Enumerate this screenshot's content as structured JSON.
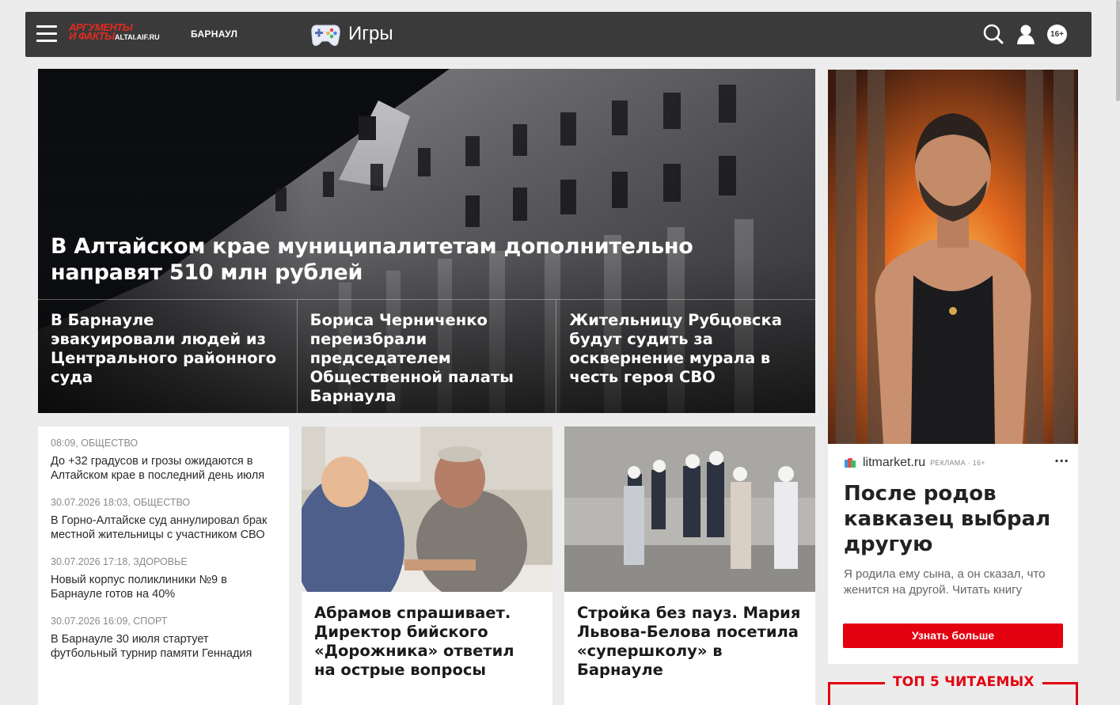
{
  "header": {
    "logo_line1": "АРГУМЕНТЫ",
    "logo_line2": "И ФАКТЫ",
    "logo_domain": "ALTAI.AIF.RU",
    "city": "БАРНАУЛ",
    "games_label": "Игры",
    "age_badge": "16+",
    "icons": [
      "menu-icon",
      "search-icon",
      "user-icon"
    ]
  },
  "hero": {
    "title": "В Алтайском крае муниципалитетам дополнительно направят 510 млн рублей",
    "sub_items": [
      "В Барнауле эвакуировали людей из Центрального районного суда",
      "Бориса Черниченко переизбрали председателем Общественной палаты Барнаула",
      "Жительницу Рубцовска будут судить за осквернение мурала в честь героя СВО"
    ]
  },
  "feed": [
    {
      "meta": "08:09, ОБЩЕСТВО",
      "text": "До +32 градусов и грозы ожидаются в Алтайском крае в последний день июля"
    },
    {
      "meta": "30.07.2026 18:03, ОБЩЕСТВО",
      "text": "В Горно-Алтайске суд аннулировал брак местной жительницы с участником СВО"
    },
    {
      "meta": "30.07.2026 17:18, ЗДОРОВЬЕ",
      "text": "Новый корпус поликлиники №9 в Барнауле готов на 40%"
    },
    {
      "meta": "30.07.2026 16:09, СПОРТ",
      "text": "В Барнауле 30 июля стартует футбольный турнир памяти Геннадия"
    }
  ],
  "cards": [
    {
      "title": "Абрамов спрашивает. Директор бийского «Дорожника» ответил на острые вопросы"
    },
    {
      "title": "Стройка без пауз. Мария Львова-Белова посетила «супершколу» в Барнауле"
    }
  ],
  "ad": {
    "domain": "litmarket.ru",
    "label": "РЕКЛАМА · 16+",
    "menu": "···",
    "title": "После родов кавказец выбрал другую",
    "description": "Я родила ему сына, а он сказал, что женится на другой. Читать книгу",
    "button": "Узнать больше"
  },
  "top5": {
    "title": "ТОП 5 ЧИТАЕМЫХ"
  },
  "colors": {
    "header_bg": "#3a3a3a",
    "brand_red": "#e3000f",
    "page_bg": "#ececec"
  }
}
